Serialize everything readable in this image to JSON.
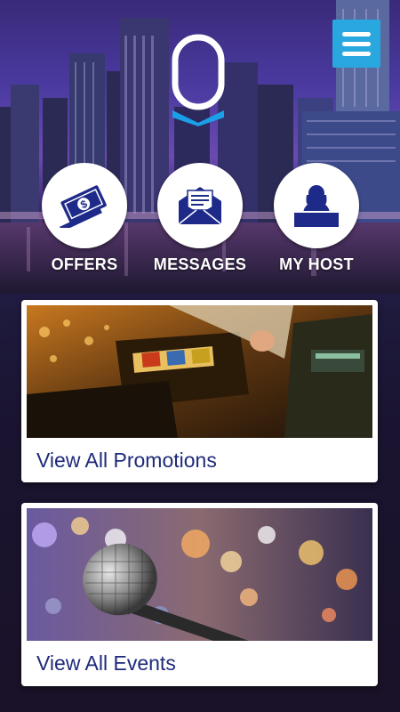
{
  "nav": [
    {
      "label": "OFFERS",
      "icon": "money-icon"
    },
    {
      "label": "MESSAGES",
      "icon": "envelope-icon"
    },
    {
      "label": "MY HOST",
      "icon": "host-icon"
    }
  ],
  "cards": [
    {
      "label": "View All Promotions",
      "image": "slot-machine-image"
    },
    {
      "label": "View All Events",
      "image": "microphone-image"
    }
  ],
  "colors": {
    "menu_button": "#29a8e0",
    "logo_chevron": "#1aa0e8",
    "icon_navy": "#1e2a8a",
    "card_text": "#1e2a7a"
  }
}
